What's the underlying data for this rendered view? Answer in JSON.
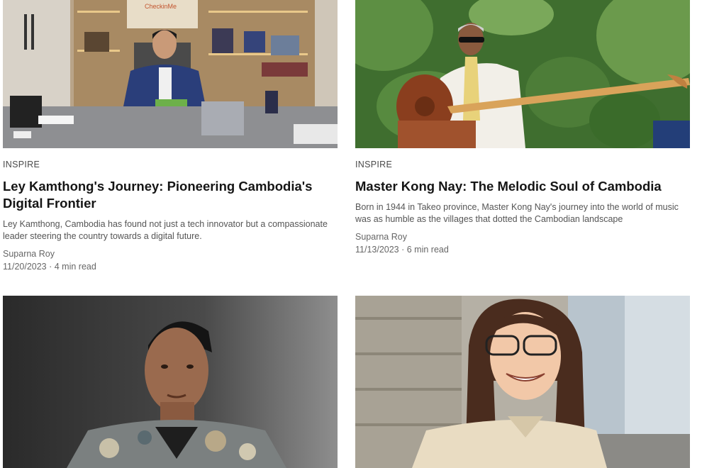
{
  "articles": [
    {
      "category": "INSPIRE",
      "title": "Ley Kamthong's Journey: Pioneering Cambodia's Digital Frontier",
      "excerpt": "Ley Kamthong, Cambodia has found not just a tech innovator but a compassionate leader steering the country towards a digital future.",
      "author": "Suparna Roy",
      "date": "11/20/2023",
      "read_time": "4 min read",
      "image_sign_text": "CheckinMe"
    },
    {
      "category": "INSPIRE",
      "title": "Master Kong Nay: The Melodic Soul of Cambodia",
      "excerpt": "Born in 1944 in Takeo province, Master Kong Nay's journey into the world of music was as humble as the villages that dotted the Cambodian landscape",
      "author": "Suparna Roy",
      "date": "11/13/2023",
      "read_time": "6 min read"
    },
    {},
    {}
  ],
  "meta_separator": " · ",
  "colors": {
    "text": "#151515",
    "muted": "#666666",
    "tag": "#4a4a4a"
  }
}
